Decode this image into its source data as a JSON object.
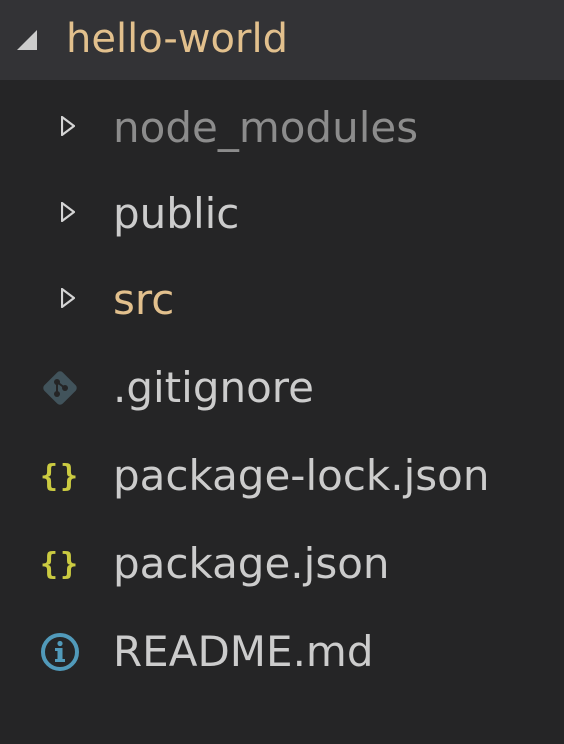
{
  "explorer": {
    "root": {
      "label": "hello-world",
      "expanded": true,
      "label_color": "#e2c08d",
      "twisty_icon": "chevron-expanded-icon"
    },
    "items": [
      {
        "label": "node_modules",
        "type": "folder",
        "icon": "chevron-right-icon",
        "color": "#8c8c8c"
      },
      {
        "label": "public",
        "type": "folder",
        "icon": "chevron-right-icon",
        "color": "#cccccc"
      },
      {
        "label": "src",
        "type": "folder",
        "icon": "chevron-right-icon",
        "color": "#e2c08d"
      },
      {
        "label": ".gitignore",
        "type": "file",
        "icon": "git-icon",
        "color": "#cccccc",
        "icon_color": "#41535b"
      },
      {
        "label": "package-lock.json",
        "type": "file",
        "icon": "json-braces-icon",
        "icon_text": "{}",
        "color": "#cccccc",
        "icon_color": "#cbcb41"
      },
      {
        "label": "package.json",
        "type": "file",
        "icon": "json-braces-icon",
        "icon_text": "{}",
        "color": "#cccccc",
        "icon_color": "#cbcb41"
      },
      {
        "label": "README.md",
        "type": "file",
        "icon": "info-icon",
        "color": "#cccccc",
        "icon_color": "#519aba"
      }
    ]
  }
}
